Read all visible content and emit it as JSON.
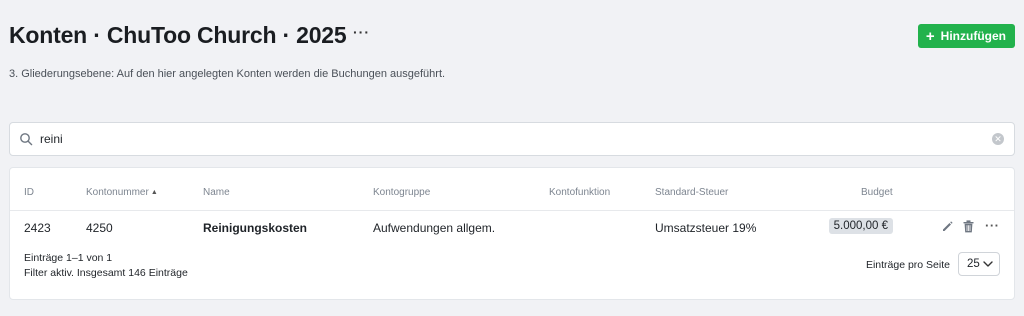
{
  "header": {
    "title": "Konten · ChuToo Church · 2025",
    "more_label": "···",
    "add_button_label": "Hinzufügen",
    "add_button_icon": "plus-icon",
    "accent_color": "#22b24c"
  },
  "subtitle": "3. Gliederungsebene: Auf den hier angelegten Konten werden die Buchungen ausgeführt.",
  "search": {
    "value": "reini",
    "icon": "search-icon",
    "clear_icon": "clear-icon"
  },
  "table": {
    "columns": [
      "ID",
      "Kontonummer",
      "Name",
      "Kontogruppe",
      "Kontofunktion",
      "Standard-Steuer",
      "Budget"
    ],
    "sorted_column": "Kontonummer",
    "sort_direction": "ascending",
    "rows": [
      {
        "id": "2423",
        "kontonummer": "4250",
        "name": "Reinigungskosten",
        "kontogruppe": "Aufwendungen allgem.",
        "kontofunktion": "",
        "steuer": "Umsatzsteuer 19%",
        "budget": "5.000,00 €",
        "actions": [
          "pencil-icon",
          "trash-icon",
          "more-icon"
        ],
        "more_label": "···"
      }
    ]
  },
  "footer": {
    "entries_text": "Einträge 1–1 von 1",
    "filter_text": "Filter aktiv. Insgesamt 146 Einträge",
    "per_page_label": "Einträge pro Seite",
    "per_page_value": "25"
  }
}
